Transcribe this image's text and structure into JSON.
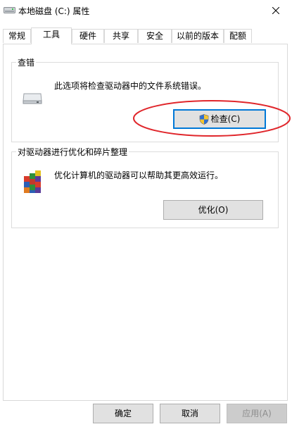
{
  "window": {
    "title": "本地磁盘 (C:) 属性",
    "close_label": "close"
  },
  "tabs": [
    {
      "label": "常规",
      "active": false
    },
    {
      "label": "工具",
      "active": true
    },
    {
      "label": "硬件",
      "active": false
    },
    {
      "label": "共享",
      "active": false
    },
    {
      "label": "安全",
      "active": false
    },
    {
      "label": "以前的版本",
      "active": false
    },
    {
      "label": "配额",
      "active": false
    }
  ],
  "error_check": {
    "group_title": "查错",
    "description": "此选项将检查驱动器中的文件系统错误。",
    "button_label": "检查(C)",
    "icon": "drive-icon",
    "button_icon": "uac-shield-icon"
  },
  "optimize": {
    "group_title": "对驱动器进行优化和碎片整理",
    "description": "优化计算机的驱动器可以帮助其更高效运行。",
    "button_label": "优化(O)",
    "icon": "defrag-icon"
  },
  "footer": {
    "ok_label": "确定",
    "cancel_label": "取消",
    "apply_label": "应用(A)"
  },
  "colors": {
    "annotation_ellipse": "#e0262b",
    "focus_border": "#0078d7"
  }
}
